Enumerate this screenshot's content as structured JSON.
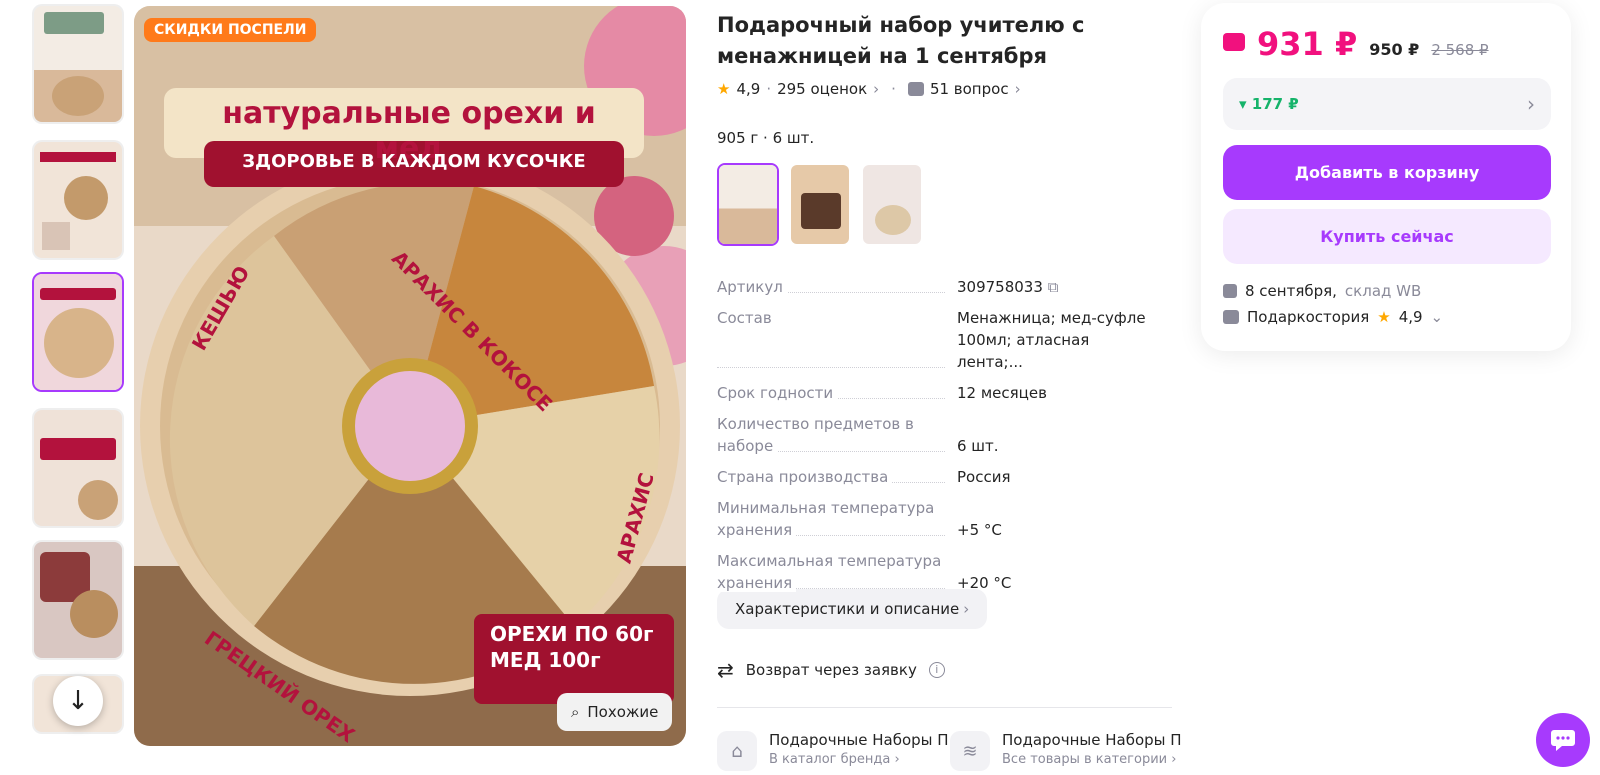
{
  "promo_badge": "СКИДКИ ПОСПЕЛИ",
  "product_image_text": {
    "headline": "натуральные орехи и мед",
    "subheadline": "ЗДОРОВЬЕ В КАЖДОМ КУСОЧКЕ",
    "label_cashew": "КЕШЬЮ",
    "label_coconut": "АРАХИС В КОКОСЕ",
    "label_peanut": "АРАХИС",
    "label_walnut": "ГРЕЦКИЙ ОРЕХ",
    "weights_line1": "ОРЕХИ ПО 60г",
    "weights_line2": "МЕД 100г"
  },
  "similar_button": "Похожие",
  "product": {
    "title": "Подарочный набор учителю с менажницей на 1 сентября",
    "rating": "4,9",
    "reviews": "295 оценок",
    "questions": "51 вопрос",
    "weight_count": "905 г · 6 шт."
  },
  "specs": [
    {
      "key": "Артикул",
      "value": "309758033"
    },
    {
      "key": "Состав",
      "value": "Менажница; мед-суфле 100мл; атласная лента;..."
    },
    {
      "key": "Срок годности",
      "value": "12 месяцев"
    },
    {
      "key": "Количество предметов в наборе",
      "value": "6 шт."
    },
    {
      "key": "Страна производства",
      "value": "Россия"
    },
    {
      "key": "Минимальная температура хранения",
      "value": "+5 °С"
    },
    {
      "key": "Максимальная температура хранения",
      "value": "+20 °С"
    }
  ],
  "description_button": "Характеристики и описание",
  "return_policy": "Возврат через заявку",
  "brand_links": [
    {
      "name": "Подарочные Наборы П",
      "sub": "В каталог бренда"
    },
    {
      "name": "Подарочные Наборы П",
      "sub": "Все товары в категории"
    }
  ],
  "buy_panel": {
    "price": "931 ₽",
    "price_without_wallet": "950 ₽",
    "price_old": "2 568 ₽",
    "promo_discount": "▾ 177 ₽",
    "add_to_cart": "Добавить в корзину",
    "buy_now": "Купить сейчас",
    "delivery_date": "8 сентября,",
    "delivery_warehouse": "склад WB",
    "seller": "Подаркостория",
    "seller_rating": "4,9"
  },
  "colors": {
    "accent": "#a73afd",
    "price": "#f1117e",
    "discount": "#15b36a",
    "promo_badge": "#ff7a1a"
  }
}
